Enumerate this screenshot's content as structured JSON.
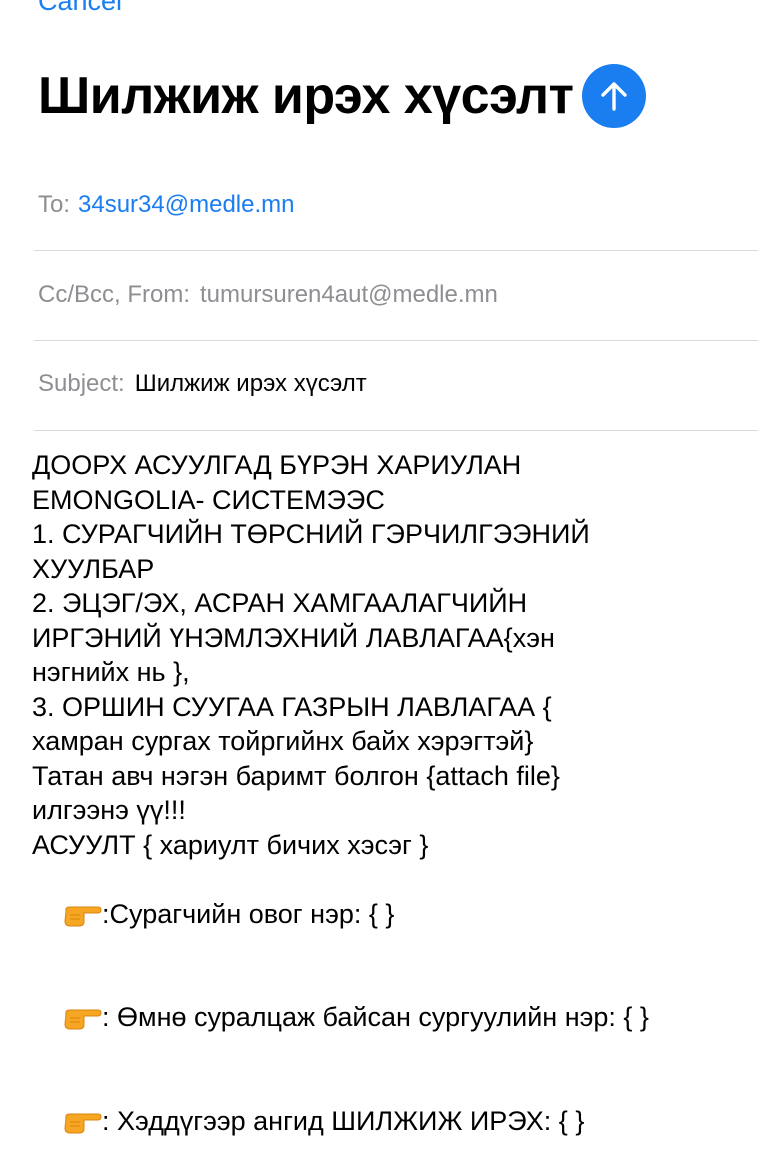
{
  "header": {
    "cancel_label": "Cancel",
    "title": "Шилжиж ирэх хүсэлт",
    "send_icon": "arrow-up-icon",
    "accent_color": "#1a7df0"
  },
  "fields": {
    "to_label": "To:",
    "to_value": "34sur34@medle.mn",
    "ccbcc_label": "Cc/Bcc, From:",
    "from_value": "tumursuren4aut@medle.mn",
    "subject_label": "Subject:",
    "subject_value": "Шилжиж ирэх хүсэлт"
  },
  "body": {
    "lines": [
      "ДООРХ АСУУЛГАД БҮРЭН ХАРИУЛАН",
      "EMONGOLIA- СИСТЕМЭЭС",
      "1. СУРАГЧИЙН ТӨРСНИЙ ГЭРЧИЛГЭЭНИЙ",
      "ХУУЛБАР",
      "2. ЭЦЭГ/ЭХ, АСРАН ХАМГААЛАГЧИЙН",
      "ИРГЭНИЙ ҮНЭМЛЭХНИЙ ЛАВЛАГАА{хэн",
      "нэгнийх нь },",
      "3. ОРШИН СУУГАА ГАЗРЫН ЛАВЛАГАА {",
      "хамран сургах тойргийнх байх хэрэгтэй}",
      "Татан авч нэгэн баримт болгон {attach file}",
      "илгээнэ үү!!!",
      "АСУУЛТ { хариулт бичих хэсэг }"
    ],
    "pointing_icon": "pointing-hand-icon",
    "questions": [
      ":Сурагчийн овог нэр: { }",
      ": Өмнө суралцаж байсан сургуулийн нэр: { }",
      ": Хэддүгээр ангид ШИЛЖИЖ ИРЭХ: { }"
    ]
  }
}
